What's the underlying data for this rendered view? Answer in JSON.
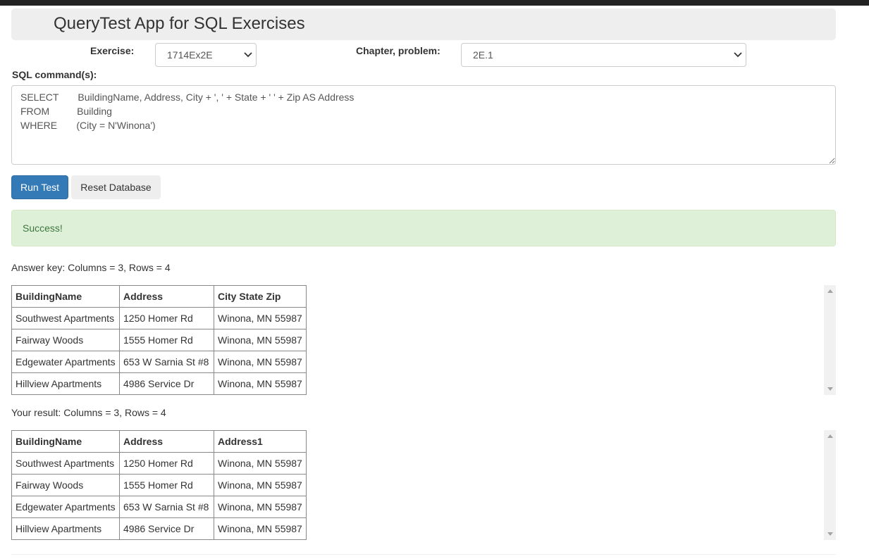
{
  "app": {
    "title": "QueryTest App for SQL Exercises"
  },
  "form": {
    "exercise_label": "Exercise:",
    "exercise_value": "1714Ex2E",
    "chapter_label": "Chapter, problem:",
    "chapter_value": "2E.1",
    "sql_label": "SQL command(s):",
    "sql_text": "SELECT       BuildingName, Address, City + ', ' + State + ' ' + Zip AS Address\nFROM          Building\nWHERE       (City = N'Winona')"
  },
  "buttons": {
    "run_test": "Run Test",
    "reset_database": "Reset Database"
  },
  "alert": {
    "message": "Success!",
    "color": "#dff0d8"
  },
  "answer_key": {
    "caption": "Answer key: Columns = 3, Rows = 4",
    "headers": [
      "BuildingName",
      "Address",
      "City State Zip"
    ],
    "rows": [
      [
        "Southwest Apartments",
        "1250 Homer Rd",
        "Winona, MN 55987"
      ],
      [
        "Fairway Woods",
        "1555 Homer Rd",
        "Winona, MN 55987"
      ],
      [
        "Edgewater Apartments",
        "653 W Sarnia St #8",
        "Winona, MN 55987"
      ],
      [
        "Hillview Apartments",
        "4986 Service Dr",
        "Winona, MN 55987"
      ]
    ]
  },
  "your_result": {
    "caption": "Your result: Columns = 3, Rows = 4",
    "headers": [
      "BuildingName",
      "Address",
      "Address1"
    ],
    "rows": [
      [
        "Southwest Apartments",
        "1250 Homer Rd",
        "Winona, MN 55987"
      ],
      [
        "Fairway Woods",
        "1555 Homer Rd",
        "Winona, MN 55987"
      ],
      [
        "Edgewater Apartments",
        "653 W Sarnia St #8",
        "Winona, MN 55987"
      ],
      [
        "Hillview Apartments",
        "4986 Service Dr",
        "Winona, MN 55987"
      ]
    ]
  },
  "colors": {
    "primary": "#337ab7",
    "success_text": "#3c763d"
  },
  "icons": {
    "select_arrow": "chevron-down-icon",
    "scroll_up": "triangle-up-icon",
    "scroll_down": "triangle-down-icon"
  }
}
